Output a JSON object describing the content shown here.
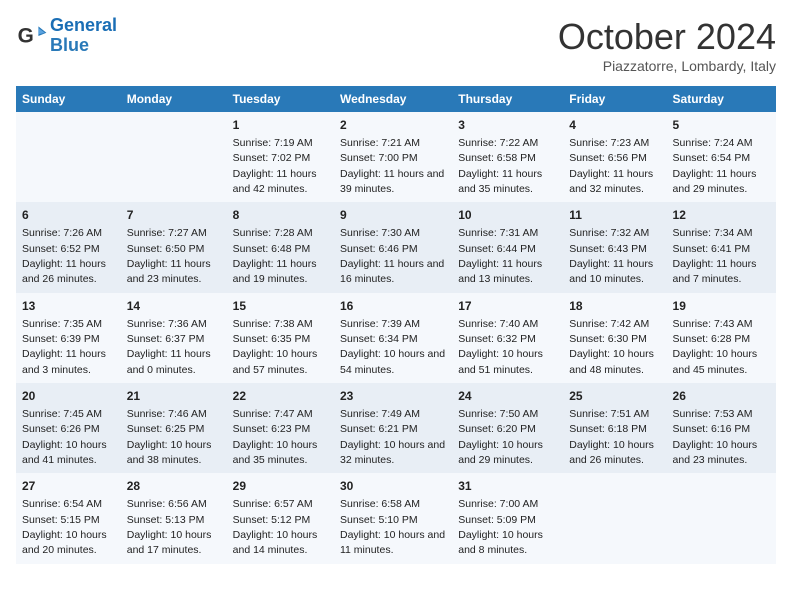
{
  "logo": {
    "line1": "General",
    "line2": "Blue"
  },
  "title": "October 2024",
  "subtitle": "Piazzatorre, Lombardy, Italy",
  "days_of_week": [
    "Sunday",
    "Monday",
    "Tuesday",
    "Wednesday",
    "Thursday",
    "Friday",
    "Saturday"
  ],
  "weeks": [
    [
      {
        "day": "",
        "info": ""
      },
      {
        "day": "",
        "info": ""
      },
      {
        "day": "1",
        "info": "Sunrise: 7:19 AM\nSunset: 7:02 PM\nDaylight: 11 hours and 42 minutes."
      },
      {
        "day": "2",
        "info": "Sunrise: 7:21 AM\nSunset: 7:00 PM\nDaylight: 11 hours and 39 minutes."
      },
      {
        "day": "3",
        "info": "Sunrise: 7:22 AM\nSunset: 6:58 PM\nDaylight: 11 hours and 35 minutes."
      },
      {
        "day": "4",
        "info": "Sunrise: 7:23 AM\nSunset: 6:56 PM\nDaylight: 11 hours and 32 minutes."
      },
      {
        "day": "5",
        "info": "Sunrise: 7:24 AM\nSunset: 6:54 PM\nDaylight: 11 hours and 29 minutes."
      }
    ],
    [
      {
        "day": "6",
        "info": "Sunrise: 7:26 AM\nSunset: 6:52 PM\nDaylight: 11 hours and 26 minutes."
      },
      {
        "day": "7",
        "info": "Sunrise: 7:27 AM\nSunset: 6:50 PM\nDaylight: 11 hours and 23 minutes."
      },
      {
        "day": "8",
        "info": "Sunrise: 7:28 AM\nSunset: 6:48 PM\nDaylight: 11 hours and 19 minutes."
      },
      {
        "day": "9",
        "info": "Sunrise: 7:30 AM\nSunset: 6:46 PM\nDaylight: 11 hours and 16 minutes."
      },
      {
        "day": "10",
        "info": "Sunrise: 7:31 AM\nSunset: 6:44 PM\nDaylight: 11 hours and 13 minutes."
      },
      {
        "day": "11",
        "info": "Sunrise: 7:32 AM\nSunset: 6:43 PM\nDaylight: 11 hours and 10 minutes."
      },
      {
        "day": "12",
        "info": "Sunrise: 7:34 AM\nSunset: 6:41 PM\nDaylight: 11 hours and 7 minutes."
      }
    ],
    [
      {
        "day": "13",
        "info": "Sunrise: 7:35 AM\nSunset: 6:39 PM\nDaylight: 11 hours and 3 minutes."
      },
      {
        "day": "14",
        "info": "Sunrise: 7:36 AM\nSunset: 6:37 PM\nDaylight: 11 hours and 0 minutes."
      },
      {
        "day": "15",
        "info": "Sunrise: 7:38 AM\nSunset: 6:35 PM\nDaylight: 10 hours and 57 minutes."
      },
      {
        "day": "16",
        "info": "Sunrise: 7:39 AM\nSunset: 6:34 PM\nDaylight: 10 hours and 54 minutes."
      },
      {
        "day": "17",
        "info": "Sunrise: 7:40 AM\nSunset: 6:32 PM\nDaylight: 10 hours and 51 minutes."
      },
      {
        "day": "18",
        "info": "Sunrise: 7:42 AM\nSunset: 6:30 PM\nDaylight: 10 hours and 48 minutes."
      },
      {
        "day": "19",
        "info": "Sunrise: 7:43 AM\nSunset: 6:28 PM\nDaylight: 10 hours and 45 minutes."
      }
    ],
    [
      {
        "day": "20",
        "info": "Sunrise: 7:45 AM\nSunset: 6:26 PM\nDaylight: 10 hours and 41 minutes."
      },
      {
        "day": "21",
        "info": "Sunrise: 7:46 AM\nSunset: 6:25 PM\nDaylight: 10 hours and 38 minutes."
      },
      {
        "day": "22",
        "info": "Sunrise: 7:47 AM\nSunset: 6:23 PM\nDaylight: 10 hours and 35 minutes."
      },
      {
        "day": "23",
        "info": "Sunrise: 7:49 AM\nSunset: 6:21 PM\nDaylight: 10 hours and 32 minutes."
      },
      {
        "day": "24",
        "info": "Sunrise: 7:50 AM\nSunset: 6:20 PM\nDaylight: 10 hours and 29 minutes."
      },
      {
        "day": "25",
        "info": "Sunrise: 7:51 AM\nSunset: 6:18 PM\nDaylight: 10 hours and 26 minutes."
      },
      {
        "day": "26",
        "info": "Sunrise: 7:53 AM\nSunset: 6:16 PM\nDaylight: 10 hours and 23 minutes."
      }
    ],
    [
      {
        "day": "27",
        "info": "Sunrise: 6:54 AM\nSunset: 5:15 PM\nDaylight: 10 hours and 20 minutes."
      },
      {
        "day": "28",
        "info": "Sunrise: 6:56 AM\nSunset: 5:13 PM\nDaylight: 10 hours and 17 minutes."
      },
      {
        "day": "29",
        "info": "Sunrise: 6:57 AM\nSunset: 5:12 PM\nDaylight: 10 hours and 14 minutes."
      },
      {
        "day": "30",
        "info": "Sunrise: 6:58 AM\nSunset: 5:10 PM\nDaylight: 10 hours and 11 minutes."
      },
      {
        "day": "31",
        "info": "Sunrise: 7:00 AM\nSunset: 5:09 PM\nDaylight: 10 hours and 8 minutes."
      },
      {
        "day": "",
        "info": ""
      },
      {
        "day": "",
        "info": ""
      }
    ]
  ]
}
